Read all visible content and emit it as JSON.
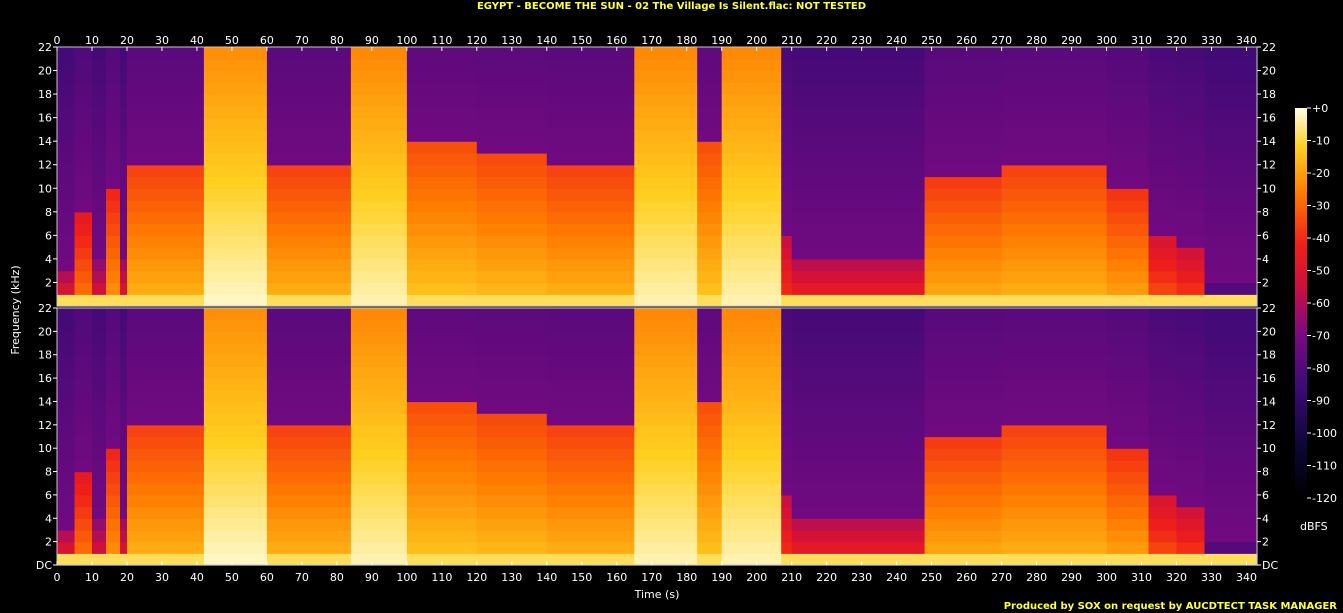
{
  "title": "EGYPT - BECOME THE SUN - 02 The Village Is Silent.flac: NOT TESTED",
  "footer": "Produced by SOX on request by AUCDTECT TASK MANAGER",
  "chart_data": {
    "type": "heatmap",
    "title": "EGYPT - BECOME THE SUN - 02 The Village Is Silent.flac: NOT TESTED",
    "xlabel": "Time (s)",
    "ylabel": "Frequency (kHz)",
    "xlim": [
      0,
      343
    ],
    "ylim": [
      0,
      22
    ],
    "x_ticks": [
      0,
      10,
      20,
      30,
      40,
      50,
      60,
      70,
      80,
      90,
      100,
      110,
      120,
      130,
      140,
      150,
      160,
      170,
      180,
      190,
      200,
      210,
      220,
      230,
      240,
      250,
      260,
      270,
      280,
      290,
      300,
      310,
      320,
      330,
      340
    ],
    "y_ticks": [
      "DC",
      2,
      4,
      6,
      8,
      10,
      12,
      14,
      16,
      18,
      20,
      22
    ],
    "channels": [
      "upper",
      "lower"
    ],
    "colorbar": {
      "label": "dBFS",
      "ticks": [
        "+0",
        -10,
        -20,
        -30,
        -40,
        -50,
        -60,
        -70,
        -80,
        -90,
        -100,
        -110,
        -120
      ],
      "range": [
        -120,
        0
      ]
    },
    "segments": [
      {
        "start": 0,
        "end": 5,
        "cutoff_khz": 3,
        "level": 0.55
      },
      {
        "start": 5,
        "end": 10,
        "cutoff_khz": 8,
        "level": 0.66
      },
      {
        "start": 10,
        "end": 14,
        "cutoff_khz": 4,
        "level": 0.5
      },
      {
        "start": 14,
        "end": 18,
        "cutoff_khz": 10,
        "level": 0.7
      },
      {
        "start": 18,
        "end": 20,
        "cutoff_khz": 4,
        "level": 0.52
      },
      {
        "start": 20,
        "end": 42,
        "cutoff_khz": 12,
        "level": 0.74
      },
      {
        "start": 42,
        "end": 60,
        "cutoff_khz": 22,
        "level": 0.85
      },
      {
        "start": 60,
        "end": 84,
        "cutoff_khz": 12,
        "level": 0.74
      },
      {
        "start": 84,
        "end": 100,
        "cutoff_khz": 22,
        "level": 0.84
      },
      {
        "start": 100,
        "end": 120,
        "cutoff_khz": 14,
        "level": 0.76
      },
      {
        "start": 120,
        "end": 140,
        "cutoff_khz": 13,
        "level": 0.75
      },
      {
        "start": 140,
        "end": 165,
        "cutoff_khz": 12,
        "level": 0.74
      },
      {
        "start": 165,
        "end": 183,
        "cutoff_khz": 22,
        "level": 0.84
      },
      {
        "start": 183,
        "end": 190,
        "cutoff_khz": 14,
        "level": 0.76
      },
      {
        "start": 190,
        "end": 207,
        "cutoff_khz": 22,
        "level": 0.84
      },
      {
        "start": 207,
        "end": 210,
        "cutoff_khz": 6,
        "level": 0.58
      },
      {
        "start": 210,
        "end": 248,
        "cutoff_khz": 4,
        "level": 0.56
      },
      {
        "start": 248,
        "end": 270,
        "cutoff_khz": 11,
        "level": 0.73
      },
      {
        "start": 270,
        "end": 300,
        "cutoff_khz": 12,
        "level": 0.74
      },
      {
        "start": 300,
        "end": 312,
        "cutoff_khz": 10,
        "level": 0.72
      },
      {
        "start": 312,
        "end": 320,
        "cutoff_khz": 6,
        "level": 0.62
      },
      {
        "start": 320,
        "end": 328,
        "cutoff_khz": 5,
        "level": 0.6
      },
      {
        "start": 328,
        "end": 343,
        "cutoff_khz": 2,
        "level": 0.38
      }
    ]
  }
}
